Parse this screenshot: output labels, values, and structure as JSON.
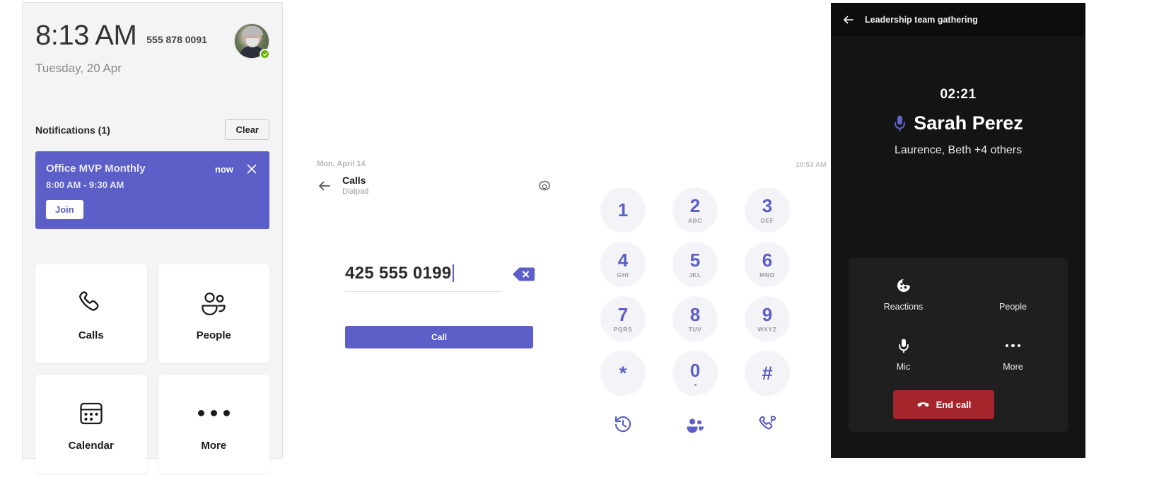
{
  "left_panel": {
    "clock": {
      "time": "8:13 AM",
      "phone_number": "555 878 0091",
      "date": "Tuesday, 20 Apr",
      "avatar_name": "avatar",
      "presence_status": "available"
    },
    "notifications": {
      "heading": "Notifications (1)",
      "clear_label": "Clear",
      "card": {
        "title": "Office MVP Monthly",
        "time_range": "8:00 AM - 9:30 AM",
        "age": "now",
        "join_label": "Join",
        "close_icon": "close-icon",
        "accent_color": "#5b5fc7"
      }
    },
    "tiles": [
      {
        "label": "Calls",
        "icon": "phone-icon"
      },
      {
        "label": "People",
        "icon": "people-icon"
      },
      {
        "label": "Calendar",
        "icon": "calendar-icon"
      },
      {
        "label": "More",
        "icon": "more-dots-icon"
      }
    ]
  },
  "middle_panel": {
    "date": "Mon, April 14",
    "time": "10:53 AM",
    "header": {
      "back_icon": "back-arrow-icon",
      "title": "Calls",
      "subtitle": "Dialpad",
      "settings_icon": "gear-icon"
    },
    "dial": {
      "number": "425 555 0199",
      "backspace_icon": "backspace-icon",
      "call_label": "Call",
      "call_color": "#5b5fc7"
    },
    "keypad": [
      {
        "num": "1",
        "letters": ""
      },
      {
        "num": "2",
        "letters": "ABC"
      },
      {
        "num": "3",
        "letters": "DEF"
      },
      {
        "num": "4",
        "letters": "GHI"
      },
      {
        "num": "5",
        "letters": "JKL"
      },
      {
        "num": "6",
        "letters": "MNO"
      },
      {
        "num": "7",
        "letters": "PQRS"
      },
      {
        "num": "8",
        "letters": "TUV"
      },
      {
        "num": "9",
        "letters": "WXYZ"
      },
      {
        "num": "*",
        "letters": ""
      },
      {
        "num": "0",
        "letters": "+"
      },
      {
        "num": "#",
        "letters": ""
      }
    ],
    "keypad_actions": [
      {
        "icon": "history-icon"
      },
      {
        "icon": "contacts-icon"
      },
      {
        "icon": "parked-call-icon"
      }
    ]
  },
  "right_panel": {
    "topbar": {
      "back_icon": "back-arrow-icon",
      "title": "Leadership team gathering"
    },
    "call": {
      "timer": "02:21",
      "speaker_icon": "mic-icon",
      "speaker_name": "Sarah Perez",
      "others": "Laurence, Beth +4 others"
    },
    "controls": [
      {
        "label": "Reactions",
        "icon": "reactions-icon"
      },
      {
        "label": "People",
        "icon": "people-icon"
      },
      {
        "label": "Mic",
        "icon": "mic-icon"
      },
      {
        "label": "More",
        "icon": "more-dots-icon"
      }
    ],
    "end_call": {
      "label": "End call",
      "icon": "end-call-icon",
      "color": "#a4262c"
    }
  }
}
